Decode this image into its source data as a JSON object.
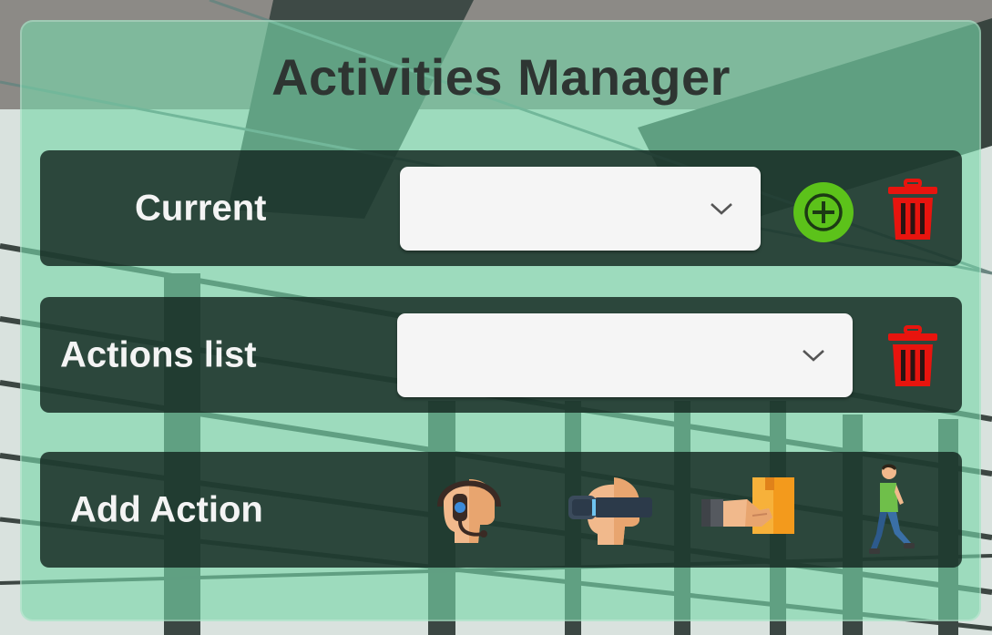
{
  "panel": {
    "title": "Activities Manager"
  },
  "current": {
    "label": "Current",
    "dropdown_value": "",
    "icons": [
      "chevron-down-icon",
      "plus-circle-icon",
      "trash-icon"
    ]
  },
  "actions_list": {
    "label": "Actions list",
    "dropdown_value": "",
    "icons": [
      "chevron-down-icon",
      "trash-icon"
    ]
  },
  "add_action": {
    "label": "Add Action",
    "actions": [
      {
        "icon": "headset-operator-icon"
      },
      {
        "icon": "vr-headset-icon"
      },
      {
        "icon": "hand-box-delivery-icon"
      },
      {
        "icon": "walking-person-icon"
      }
    ]
  },
  "colors": {
    "panel_bg": "#78d6aa",
    "row_bg": "#142620",
    "add_green": "#5cc21a",
    "delete_red": "#e8140e",
    "title_text": "#2e3532"
  }
}
